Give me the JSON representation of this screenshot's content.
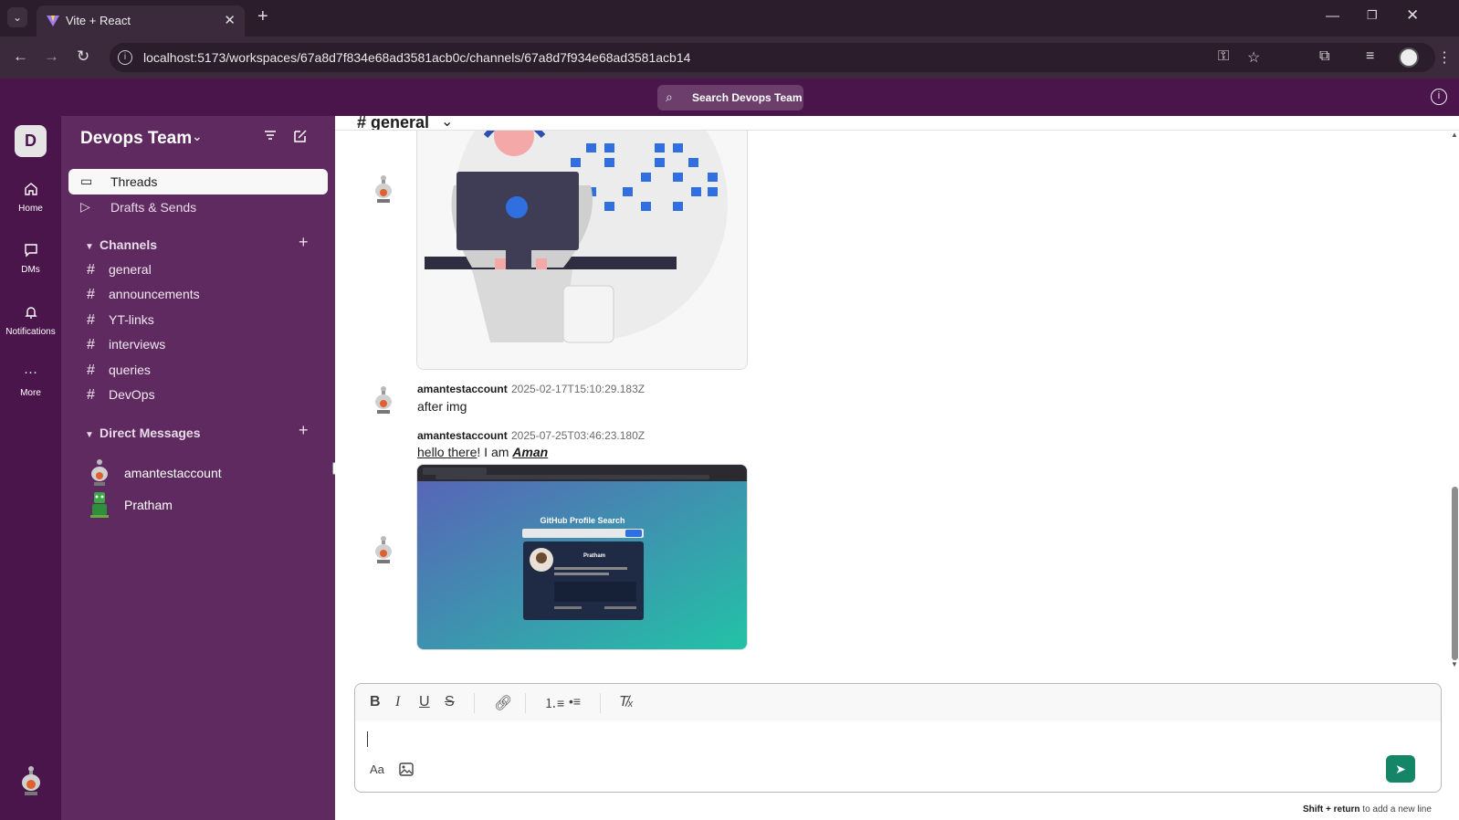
{
  "browser": {
    "tab_title": "Vite + React",
    "url": "localhost:5173/workspaces/67a8d7f834e68ad3581acb0c/channels/67a8d7f934e68ad3581acb14"
  },
  "topbar": {
    "search_label": "Search Devops Team"
  },
  "rail": {
    "workspace_initial": "D",
    "items": [
      {
        "label": "Home"
      },
      {
        "label": "DMs"
      },
      {
        "label": "Notifications"
      },
      {
        "label": "More"
      }
    ]
  },
  "sidebar": {
    "workspace_name": "Devops Team",
    "nav": [
      {
        "label": "Threads",
        "active": true
      },
      {
        "label": "Drafts & Sends",
        "active": false
      }
    ],
    "channels_heading": "Channels",
    "channels": [
      "general",
      "announcements",
      "YT-links",
      "interviews",
      "queries",
      "DevOps"
    ],
    "dm_heading": "Direct Messages",
    "dms": [
      "amantestaccount",
      "Pratham"
    ]
  },
  "channel": {
    "name": "# general"
  },
  "messages": [
    {
      "author": "amantestaccount",
      "time": "2025-02-17T15:10:29.183Z",
      "text": "after img"
    },
    {
      "author": "amantestaccount",
      "time": "2025-07-25T03:46:23.180Z",
      "text_link": "hello there",
      "text_mid": "! I am ",
      "text_em": "Aman"
    }
  ],
  "screenshot_preview": {
    "title": "GitHub Profile Search",
    "profile_name": "Pratham"
  },
  "composer": {
    "value": "",
    "hint_keys": "Shift + return",
    "hint_text": "to add a new line"
  }
}
